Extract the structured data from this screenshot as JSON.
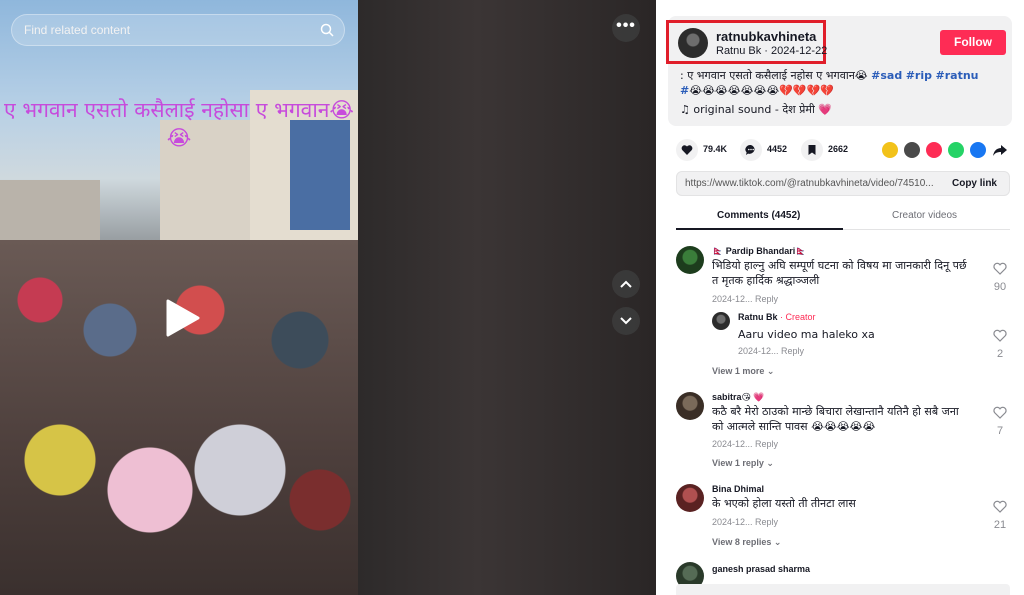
{
  "search": {
    "placeholder": "Find related content"
  },
  "video": {
    "overlay_text": "ए भगवान एसतो कसैलाई नहोसा ए भगवान😭😭"
  },
  "post": {
    "username": "ratnubkavhineta",
    "display_name": "Ratnu Bk",
    "date": "2024-12-22",
    "follow_label": "Follow",
    "description": ": ए भगवान एसतो कसैलाई नहोस ए भगवान😭",
    "hashtags": [
      "#sad",
      "#rip",
      "#ratnu"
    ],
    "desc_line2_prefix": "#",
    "desc_emojis": "😭😭😭😭😭😭😭💔💔💔💔",
    "sound": "original sound - देश प्रेमी 💗",
    "likes": "79.4K",
    "comments": "4452",
    "saves": "2662",
    "link": "https://www.tiktok.com/@ratnubkavhineta/video/74510...",
    "copy_link_label": "Copy link"
  },
  "tabs": {
    "comments": "Comments (4452)",
    "creator_videos": "Creator videos"
  },
  "comments": [
    {
      "name": "🇳🇵 Pardip Bhandari🇳🇵",
      "text": "भिडियो हाल्नु अघि सम्पूर्ण घटना को विषय मा जानकारी दिनू पर्छ त मृतक हार्दिक श्रद्धाञ्जली",
      "time": "2024-12...",
      "reply_label": "Reply",
      "likes": "90"
    },
    {
      "name": "Ratnu Bk",
      "badge": "· Creator",
      "text": "Aaru video ma haleko xa",
      "time": "2024-12...",
      "reply_label": "Reply",
      "likes": "2"
    },
    {
      "name": "sabitra😘 💗",
      "text": "कठै बरै मेरो ठाउको मान्छे बिचारा लेखान्तानै यतिनै हो सबै जना को आत्मले सान्ति पावस 😭😭😭😭😭",
      "time": "2024-12...",
      "reply_label": "Reply",
      "likes": "7"
    },
    {
      "name": "Bina Dhimal",
      "text": "के भएको होला यस्तो ती तीनटा लास",
      "time": "2024-12...",
      "reply_label": "Reply",
      "likes": "21"
    },
    {
      "name": "ganesh prasad sharma"
    }
  ],
  "view_more": {
    "first": "View 1 more",
    "second": "View 1 reply",
    "third": "View 8 replies"
  },
  "colors": {
    "accent": "#fe2c55",
    "hashtag": "#2b5db9",
    "highlight": "#e01e2a"
  }
}
